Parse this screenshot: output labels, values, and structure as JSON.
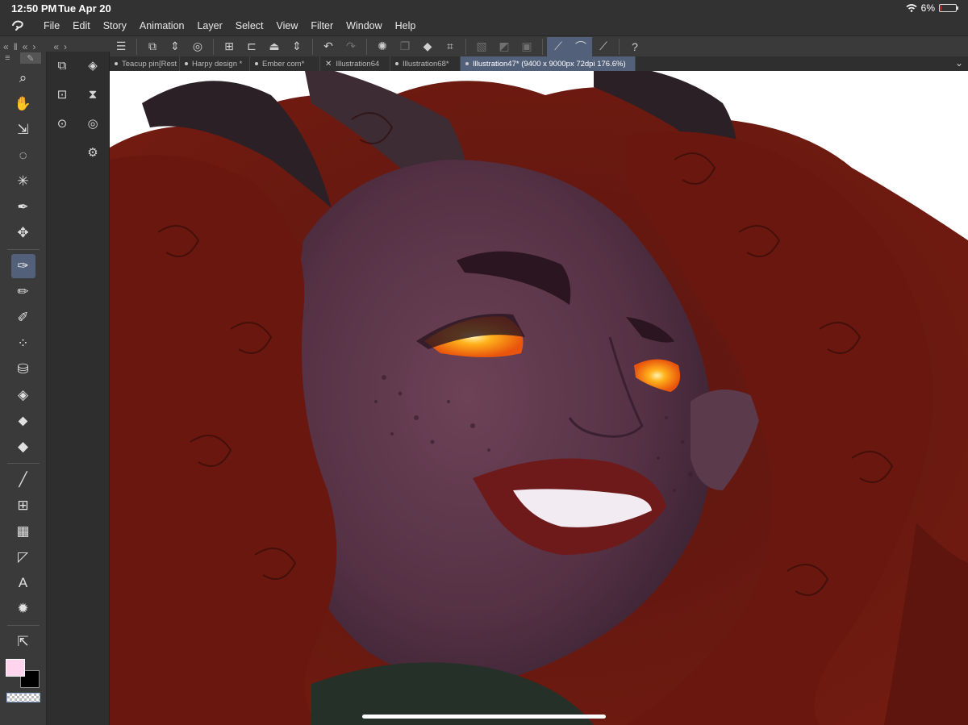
{
  "status_bar": {
    "time": "12:50 PM",
    "date": "Tue Apr 20",
    "battery": "6%",
    "battery_level": 0.06
  },
  "menu": {
    "items": [
      "File",
      "Edit",
      "Story",
      "Animation",
      "Layer",
      "Select",
      "View",
      "Filter",
      "Window",
      "Help"
    ]
  },
  "commandbar": {
    "icons": [
      "menu-icon",
      "transform-icon",
      "reorder-icon",
      "spiral-icon",
      "new-layer-icon",
      "open-folder-icon",
      "save-icon",
      "undo-icon",
      "redo-icon",
      "loading-icon",
      "copy-icon",
      "fill-icon",
      "crop-icon",
      "hide-selection-icon",
      "invert-icon",
      "border-icon",
      "snap-ruler-icon",
      "snap-special-icon",
      "snap-grid-icon",
      "help-icon"
    ]
  },
  "tool_panel": {
    "tools": [
      "zoom-icon",
      "hand-icon",
      "move-layer-icon",
      "lasso-icon",
      "magic-wand-icon",
      "eyedropper-icon",
      "move-icon",
      "pen-icon",
      "pencil-icon",
      "brush-icon",
      "airbrush-icon",
      "decoration-icon",
      "fill-icon",
      "eraser-icon",
      "blend-icon",
      "line-icon",
      "frame-icon",
      "gradient-icon",
      "correction-icon",
      "text-icon",
      "burst-icon",
      "operation-icon"
    ],
    "selected_tool": "pen-icon",
    "main_color": "#ffd4ec",
    "sub_color": "#000000"
  },
  "subtool_panel": {
    "icons": [
      "layers-icon",
      "layer-stack-icon",
      "reference-icon",
      "layer-add-icon",
      "navigator-icon",
      "layer-search-icon",
      "",
      "layer-settings-icon"
    ]
  },
  "tabs": [
    {
      "label": "Teacup pin[Rest",
      "active": false,
      "marker": "dot"
    },
    {
      "label": "Harpy design *",
      "active": false,
      "marker": "dot"
    },
    {
      "label": "Ember com*",
      "active": false,
      "marker": "dot"
    },
    {
      "label": "Illustration64",
      "active": false,
      "marker": "x"
    },
    {
      "label": "Illustration68*",
      "active": false,
      "marker": "dot"
    },
    {
      "label": "Illustration47* (9400 x 9000px 72dpi 176.6%)",
      "active": true,
      "marker": "dot"
    }
  ],
  "colors": {
    "hair": "#6e1a10",
    "skin": "#5a3446",
    "eye_glow": "#ff9a18",
    "lips": "#6e1a1a",
    "horn": "#3a2a30",
    "accent": "#53607a"
  }
}
